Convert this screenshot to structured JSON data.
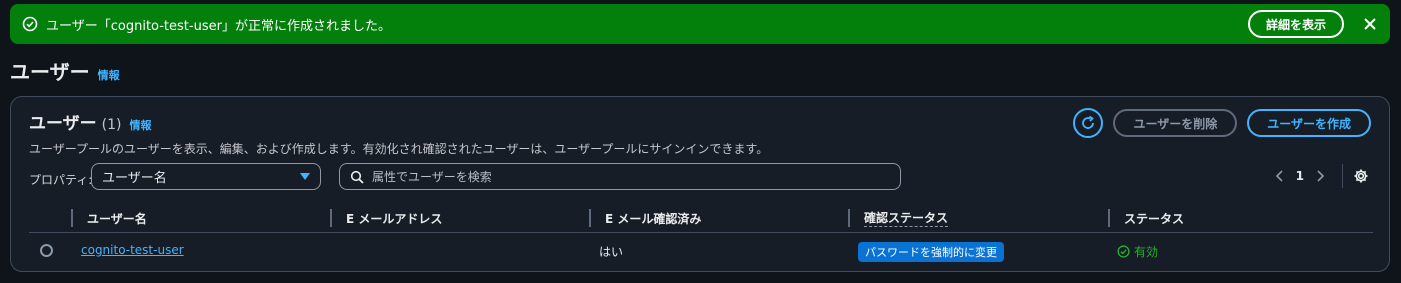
{
  "flash": {
    "message": "ユーザー「cognito-test-user」が正常に作成されました。",
    "details_label": "詳細を表示",
    "icons": {
      "status": "success-icon",
      "close": "close-icon"
    },
    "color": "#037f0c"
  },
  "page": {
    "title": "ユーザー",
    "info_label": "情報"
  },
  "section": {
    "title": "ユーザー",
    "count": "(1)",
    "info_label": "情報",
    "description": "ユーザープールのユーザーを表示、編集、および作成します。有効化され確認されたユーザーは、ユーザープールにサインインできます。",
    "delete_label": "ユーザーを削除",
    "create_label": "ユーザーを作成"
  },
  "filter": {
    "property_label": "プロパティ:",
    "property_value": "ユーザー名",
    "search_placeholder": "属性でユーザーを検索"
  },
  "pagination": {
    "current_page": "1"
  },
  "table": {
    "columns": [
      "ユーザー名",
      "E メールアドレス",
      "E メール確認済み",
      "確認ステータス",
      "ステータス"
    ],
    "rows": [
      {
        "username": "cognito-test-user",
        "email": "",
        "email_verified": "はい",
        "confirmation_status": "パスワードを強制的に変更",
        "status": "有効"
      }
    ]
  },
  "colors": {
    "accent": "#42b4ff",
    "success": "#29ad32",
    "badge": "#0972d3",
    "background": "#0f141a"
  }
}
